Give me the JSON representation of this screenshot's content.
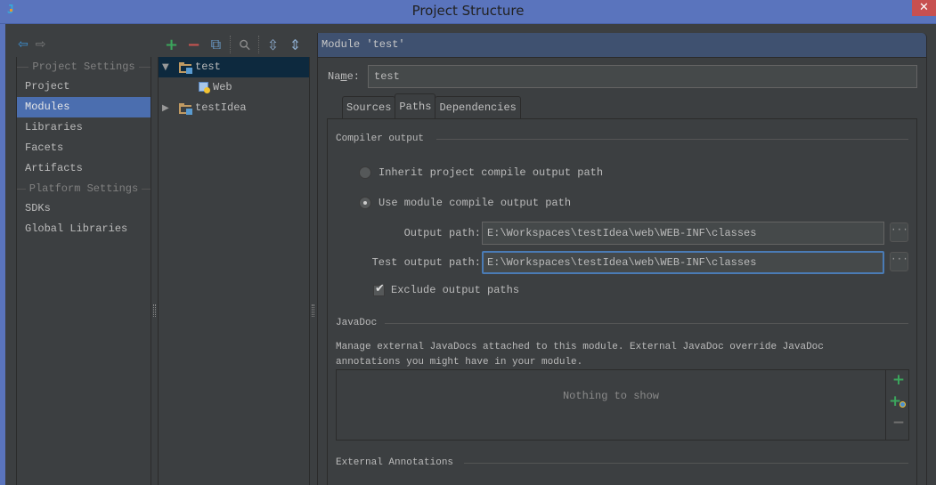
{
  "window": {
    "title": "Project Structure",
    "app_icon": "intellij-idea-icon",
    "close_glyph": "✕"
  },
  "nav": {
    "back_glyph": "⇦",
    "forward_glyph": "⇨",
    "back_color": "#3d8fd1",
    "forward_color": "#7a7a7a"
  },
  "sidebar": {
    "sections": [
      {
        "header": "Project Settings",
        "items": [
          {
            "label": "Project",
            "selected": false
          },
          {
            "label": "Modules",
            "selected": true
          },
          {
            "label": "Libraries",
            "selected": false
          },
          {
            "label": "Facets",
            "selected": false
          },
          {
            "label": "Artifacts",
            "selected": false
          }
        ]
      },
      {
        "header": "Platform Settings",
        "items": [
          {
            "label": "SDKs",
            "selected": false
          },
          {
            "label": "Global Libraries",
            "selected": false
          }
        ]
      }
    ]
  },
  "tree_toolbar": {
    "add": {
      "glyph": "+",
      "color": "#3ba55c"
    },
    "remove": {
      "glyph": "−",
      "color": "#c75450"
    },
    "copy": {
      "glyph": "⧉",
      "color": "#6a9bc8"
    },
    "find": {
      "glyph": "⚲",
      "color": "#8a8a8a"
    },
    "expand_all": {
      "glyph": "⇳",
      "color": "#8aa8c8"
    },
    "collapse_all": {
      "glyph": "⇕",
      "color": "#8aa8c8"
    }
  },
  "tree": {
    "nodes": [
      {
        "label": "test",
        "expanded": true,
        "selected": true,
        "type": "module"
      },
      {
        "label": "Web",
        "type": "facet-web"
      },
      {
        "label": "testIdea",
        "expanded": false,
        "selected": false,
        "type": "module"
      }
    ],
    "expanded_glyph": "▼",
    "collapsed_glyph": "▶"
  },
  "module": {
    "header": "Module 'test'",
    "name_label_pre": "Na",
    "name_label_mnemonic": "m",
    "name_label_post": "e:",
    "name_value": "test",
    "tabs": [
      {
        "label": "Sources",
        "selected": false
      },
      {
        "label": "Paths",
        "selected": true
      },
      {
        "label": "Dependencies",
        "selected": false
      }
    ]
  },
  "paths": {
    "compiler_output_title": "Compiler output",
    "radio_inherit": {
      "label": "Inherit project compile output path",
      "checked": false
    },
    "radio_module": {
      "label": "Use module compile output path",
      "checked": true
    },
    "output_path": {
      "label": "Output path:",
      "value": "E:\\Workspaces\\testIdea\\web\\WEB-INF\\classes"
    },
    "test_output_path": {
      "label": "Test output path:",
      "value": "E:\\Workspaces\\testIdea\\web\\WEB-INF\\classes"
    },
    "browse_glyph": "···",
    "exclude_output": {
      "label": "Exclude output paths",
      "checked": true
    },
    "javadoc_title": "JavaDoc",
    "javadoc_desc_line1": "Manage external JavaDocs attached to this module. External JavaDoc override JavaDoc",
    "javadoc_desc_line2": "annotations you might have in your module.",
    "javadoc_empty": "Nothing to show",
    "javadoc_add_glyph": "+",
    "javadoc_add_url_glyph": "+",
    "javadoc_remove_glyph": "−",
    "external_annotations_title": "External Annotations"
  },
  "colors": {
    "titlebar": "#5a74bd",
    "selection": "#4b6eaf",
    "tree_selection": "#0d293e",
    "header": "#3f5170",
    "background": "#3c3f41",
    "focus_border": "#4a7bb5",
    "close_button": "#c75050"
  }
}
